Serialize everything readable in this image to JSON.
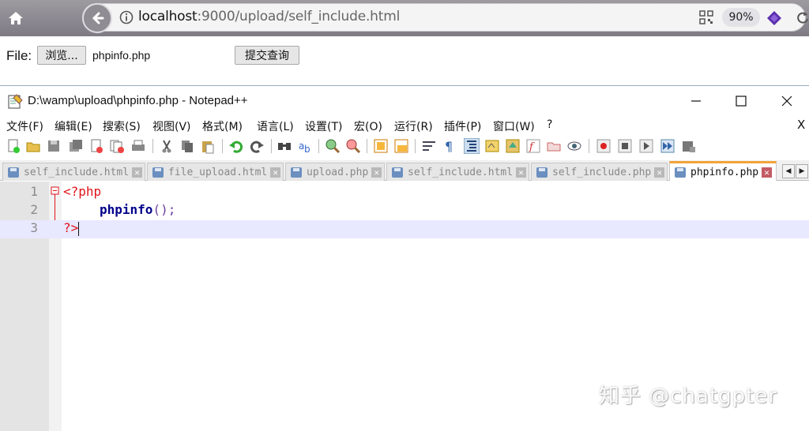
{
  "browser": {
    "url_host": "localhost",
    "url_rest": ":9000/upload/self_include.html",
    "zoom": "90%"
  },
  "page": {
    "file_label": "File:",
    "browse_label": "浏览...",
    "filename": "phpinfo.php",
    "submit_label": "提交查询"
  },
  "npp": {
    "title": "D:\\wamp\\upload\\phpinfo.php - Notepad++",
    "menu": [
      "文件(F)",
      "编辑(E)",
      "搜索(S)",
      "视图(V)",
      "格式(M)",
      "语言(L)",
      "设置(T)",
      "宏(O)",
      "运行(R)",
      "插件(P)",
      "窗口(W)",
      "?"
    ],
    "menu_close": "X",
    "tabs": [
      {
        "label": "self_include.html"
      },
      {
        "label": "file_upload.html"
      },
      {
        "label": "upload.php"
      },
      {
        "label": "self_include.html"
      },
      {
        "label": "self_include.php"
      },
      {
        "label": "phpinfo.php",
        "active": true
      }
    ],
    "code": {
      "line1_num": "1",
      "line2_num": "2",
      "line3_num": "3",
      "open_tag": "<?php",
      "func_name": "phpinfo",
      "call_suffix": "();",
      "close_tag": "?>"
    }
  },
  "watermark": "知乎 @chatgpter"
}
